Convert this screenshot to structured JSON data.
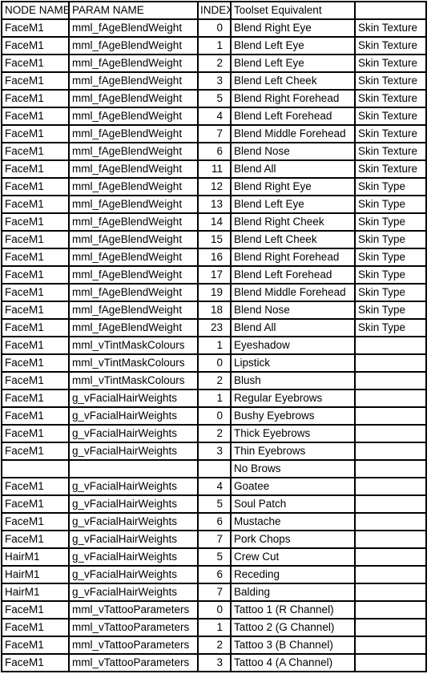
{
  "table": {
    "columns": [
      {
        "key": "node_name",
        "label": "NODE NAME",
        "align": "left"
      },
      {
        "key": "param_name",
        "label": "PARAM NAME",
        "align": "left"
      },
      {
        "key": "index",
        "label": "INDEX",
        "align": "right"
      },
      {
        "key": "toolset_equivalent",
        "label": "Toolset Equivalent",
        "align": "left"
      },
      {
        "key": "category",
        "label": "",
        "align": "left"
      }
    ],
    "rows": [
      {
        "node_name": "FaceM1",
        "param_name": "mml_fAgeBlendWeight",
        "index": "0",
        "toolset_equivalent": "Blend Right Eye",
        "category": "Skin Texture"
      },
      {
        "node_name": "FaceM1",
        "param_name": "mml_fAgeBlendWeight",
        "index": "1",
        "toolset_equivalent": "Blend Left Eye",
        "category": "Skin Texture"
      },
      {
        "node_name": "FaceM1",
        "param_name": "mml_fAgeBlendWeight",
        "index": "2",
        "toolset_equivalent": "Blend Left Eye",
        "category": "Skin Texture"
      },
      {
        "node_name": "FaceM1",
        "param_name": "mml_fAgeBlendWeight",
        "index": "3",
        "toolset_equivalent": "Blend Left Cheek",
        "category": "Skin Texture"
      },
      {
        "node_name": "FaceM1",
        "param_name": "mml_fAgeBlendWeight",
        "index": "5",
        "toolset_equivalent": "Blend Right Forehead",
        "category": "Skin Texture"
      },
      {
        "node_name": "FaceM1",
        "param_name": "mml_fAgeBlendWeight",
        "index": "4",
        "toolset_equivalent": "Blend Left Forehead",
        "category": "Skin Texture"
      },
      {
        "node_name": "FaceM1",
        "param_name": "mml_fAgeBlendWeight",
        "index": "7",
        "toolset_equivalent": "Blend Middle Forehead",
        "category": "Skin Texture"
      },
      {
        "node_name": "FaceM1",
        "param_name": "mml_fAgeBlendWeight",
        "index": "6",
        "toolset_equivalent": "Blend Nose",
        "category": "Skin Texture"
      },
      {
        "node_name": "FaceM1",
        "param_name": "mml_fAgeBlendWeight",
        "index": "11",
        "toolset_equivalent": "Blend All",
        "category": "Skin Texture"
      },
      {
        "node_name": "FaceM1",
        "param_name": "mml_fAgeBlendWeight",
        "index": "12",
        "toolset_equivalent": "Blend Right Eye",
        "category": "Skin Type"
      },
      {
        "node_name": "FaceM1",
        "param_name": "mml_fAgeBlendWeight",
        "index": "13",
        "toolset_equivalent": "Blend Left Eye",
        "category": "Skin Type"
      },
      {
        "node_name": "FaceM1",
        "param_name": "mml_fAgeBlendWeight",
        "index": "14",
        "toolset_equivalent": "Blend Right Cheek",
        "category": "Skin Type"
      },
      {
        "node_name": "FaceM1",
        "param_name": "mml_fAgeBlendWeight",
        "index": "15",
        "toolset_equivalent": "Blend Left Cheek",
        "category": "Skin Type"
      },
      {
        "node_name": "FaceM1",
        "param_name": "mml_fAgeBlendWeight",
        "index": "16",
        "toolset_equivalent": "Blend Right Forehead",
        "category": "Skin Type"
      },
      {
        "node_name": "FaceM1",
        "param_name": "mml_fAgeBlendWeight",
        "index": "17",
        "toolset_equivalent": "Blend Left Forehead",
        "category": "Skin Type"
      },
      {
        "node_name": "FaceM1",
        "param_name": "mml_fAgeBlendWeight",
        "index": "19",
        "toolset_equivalent": "Blend Middle Forehead",
        "category": "Skin Type"
      },
      {
        "node_name": "FaceM1",
        "param_name": "mml_fAgeBlendWeight",
        "index": "18",
        "toolset_equivalent": "Blend Nose",
        "category": "Skin Type"
      },
      {
        "node_name": "FaceM1",
        "param_name": "mml_fAgeBlendWeight",
        "index": "23",
        "toolset_equivalent": "Blend All",
        "category": "Skin Type"
      },
      {
        "node_name": "FaceM1",
        "param_name": "mml_vTintMaskColours",
        "index": "1",
        "toolset_equivalent": "Eyeshadow",
        "category": ""
      },
      {
        "node_name": "FaceM1",
        "param_name": "mml_vTintMaskColours",
        "index": "0",
        "toolset_equivalent": "Lipstick",
        "category": ""
      },
      {
        "node_name": "FaceM1",
        "param_name": "mml_vTintMaskColours",
        "index": "2",
        "toolset_equivalent": "Blush",
        "category": ""
      },
      {
        "node_name": "FaceM1",
        "param_name": "g_vFacialHairWeights",
        "index": "1",
        "toolset_equivalent": "Regular Eyebrows",
        "category": ""
      },
      {
        "node_name": "FaceM1",
        "param_name": "g_vFacialHairWeights",
        "index": "0",
        "toolset_equivalent": "Bushy Eyebrows",
        "category": ""
      },
      {
        "node_name": "FaceM1",
        "param_name": "g_vFacialHairWeights",
        "index": "2",
        "toolset_equivalent": "Thick Eyebrows",
        "category": ""
      },
      {
        "node_name": "FaceM1",
        "param_name": "g_vFacialHairWeights",
        "index": "3",
        "toolset_equivalent": "Thin Eyebrows",
        "category": ""
      },
      {
        "node_name": "",
        "param_name": "",
        "index": "",
        "toolset_equivalent": "No Brows",
        "category": ""
      },
      {
        "node_name": "FaceM1",
        "param_name": "g_vFacialHairWeights",
        "index": "4",
        "toolset_equivalent": "Goatee",
        "category": ""
      },
      {
        "node_name": "FaceM1",
        "param_name": "g_vFacialHairWeights",
        "index": "5",
        "toolset_equivalent": "Soul Patch",
        "category": ""
      },
      {
        "node_name": "FaceM1",
        "param_name": "g_vFacialHairWeights",
        "index": "6",
        "toolset_equivalent": "Mustache",
        "category": ""
      },
      {
        "node_name": "FaceM1",
        "param_name": "g_vFacialHairWeights",
        "index": "7",
        "toolset_equivalent": "Pork Chops",
        "category": ""
      },
      {
        "node_name": "HairM1",
        "param_name": "g_vFacialHairWeights",
        "index": "5",
        "toolset_equivalent": "Crew Cut",
        "category": ""
      },
      {
        "node_name": "HairM1",
        "param_name": "g_vFacialHairWeights",
        "index": "6",
        "toolset_equivalent": "Receding",
        "category": ""
      },
      {
        "node_name": "HairM1",
        "param_name": "g_vFacialHairWeights",
        "index": "7",
        "toolset_equivalent": "Balding",
        "category": ""
      },
      {
        "node_name": "FaceM1",
        "param_name": "mml_vTattooParameters",
        "index": "0",
        "toolset_equivalent": "Tattoo 1 (R Channel)",
        "category": ""
      },
      {
        "node_name": "FaceM1",
        "param_name": "mml_vTattooParameters",
        "index": "1",
        "toolset_equivalent": "Tattoo 2 (G Channel)",
        "category": ""
      },
      {
        "node_name": "FaceM1",
        "param_name": "mml_vTattooParameters",
        "index": "2",
        "toolset_equivalent": "Tattoo 3 (B Channel)",
        "category": ""
      },
      {
        "node_name": "FaceM1",
        "param_name": "mml_vTattooParameters",
        "index": "3",
        "toolset_equivalent": "Tattoo 4  (A Channel)",
        "category": ""
      }
    ]
  },
  "style": {
    "border_color": "#000000",
    "text_color": "#000000",
    "background": "#ffffff"
  }
}
